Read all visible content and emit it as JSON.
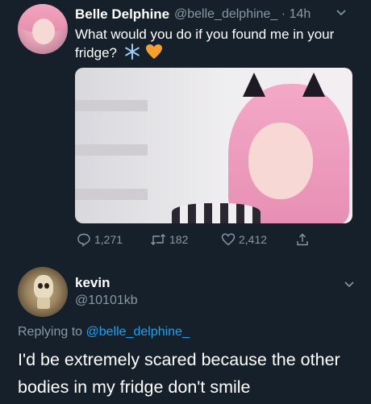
{
  "tweet": {
    "author_name": "Belle Delphine",
    "handle": "@belle_delphine_",
    "separator": "·",
    "time": "14h",
    "text": "What would you do if you found me in your fridge?",
    "emojis": [
      "snowflake",
      "orange-heart"
    ],
    "actions": {
      "replies": "1,271",
      "retweets": "182",
      "likes": "2,412"
    }
  },
  "reply": {
    "author_name": "kevin",
    "handle": "@10101kb",
    "replying_prefix": "Replying to",
    "replying_to": "@belle_delphine_",
    "text": "I'd be extremely scared because the other bodies in my fridge don't smile"
  },
  "colors": {
    "background": "#15202b",
    "secondary_text": "#8899a6",
    "link": "#1da1f2",
    "emoji_heart": "#f4a030",
    "emoji_snowflake": "#9ecbf0"
  }
}
